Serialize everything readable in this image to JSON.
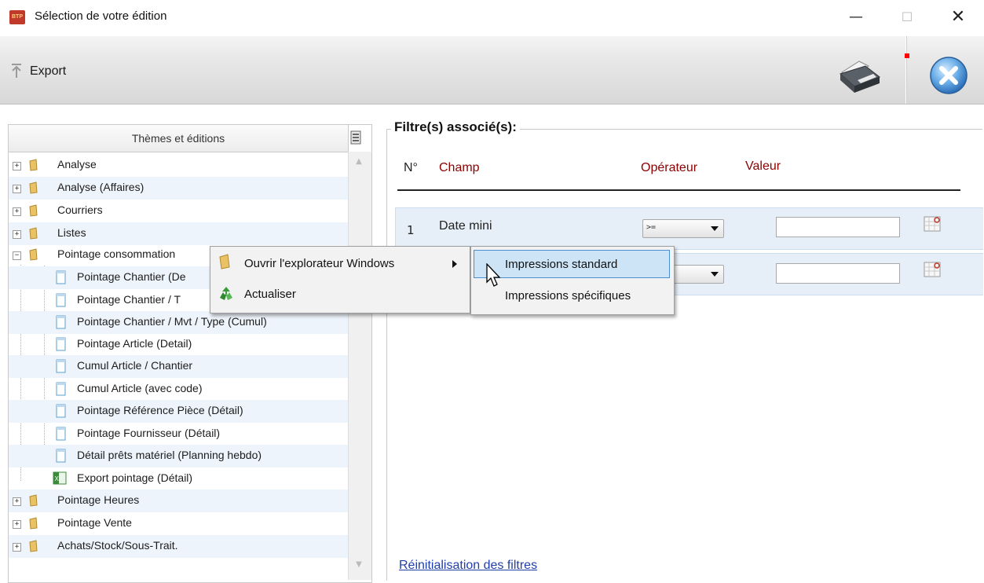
{
  "window": {
    "title": "Sélection de votre édition",
    "app_icon_text": "BTP"
  },
  "toolbar": {
    "export_label": "Export"
  },
  "tree": {
    "header": "Thèmes et éditions",
    "items": [
      {
        "label": "Analyse",
        "type": "folder",
        "expander": "+"
      },
      {
        "label": "Analyse (Affaires)",
        "type": "folder",
        "expander": "+"
      },
      {
        "label": "Courriers",
        "type": "folder",
        "expander": "+"
      },
      {
        "label": "Listes",
        "type": "folder",
        "expander": "+"
      },
      {
        "label": "Pointage consommation",
        "type": "folder",
        "expander": "−"
      },
      {
        "label": "Pointage Chantier (De",
        "type": "doc"
      },
      {
        "label": "Pointage Chantier / T",
        "type": "doc"
      },
      {
        "label": "Pointage Chantier / Mvt / Type (Cumul)",
        "type": "doc"
      },
      {
        "label": "Pointage Article (Detail)",
        "type": "doc"
      },
      {
        "label": "Cumul Article / Chantier",
        "type": "doc"
      },
      {
        "label": "Cumul Article (avec code)",
        "type": "doc"
      },
      {
        "label": "Pointage Référence Pièce (Détail)",
        "type": "doc"
      },
      {
        "label": "Pointage Fournisseur (Détail)",
        "type": "doc"
      },
      {
        "label": "Détail prêts matériel (Planning hebdo)",
        "type": "doc"
      },
      {
        "label": "Export pointage (Détail)",
        "type": "excel"
      },
      {
        "label": "Pointage Heures",
        "type": "folder",
        "expander": "+"
      },
      {
        "label": "Pointage Vente",
        "type": "folder",
        "expander": "+"
      },
      {
        "label": "Achats/Stock/Sous-Trait.",
        "type": "folder",
        "expander": "+"
      }
    ]
  },
  "filters": {
    "title": "Filtre(s) associé(s):",
    "columns": {
      "num": "N°",
      "champ": "Champ",
      "operateur": "Opérateur",
      "valeur": "Valeur"
    },
    "rows": [
      {
        "num": "1",
        "champ": "Date mini",
        "operateur": ">=",
        "valeur": ""
      },
      {
        "num": "",
        "champ": "",
        "operateur": "",
        "valeur": ""
      }
    ],
    "reset_link": "Réinitialisation des filtres"
  },
  "context_menu": {
    "items": [
      {
        "label": "Ouvrir l'explorateur Windows",
        "has_submenu": true,
        "icon": "folder-icon"
      },
      {
        "label": "Actualiser",
        "icon": "refresh-icon"
      }
    ],
    "submenu": [
      {
        "label": "Impressions standard",
        "highlighted": true
      },
      {
        "label": "Impressions spécifiques"
      }
    ]
  },
  "colors": {
    "accent_red": "#8b0000",
    "link_blue": "#1f3ea8",
    "highlight_blue": "#cde4f7",
    "row_alt": "#eef4fb"
  }
}
